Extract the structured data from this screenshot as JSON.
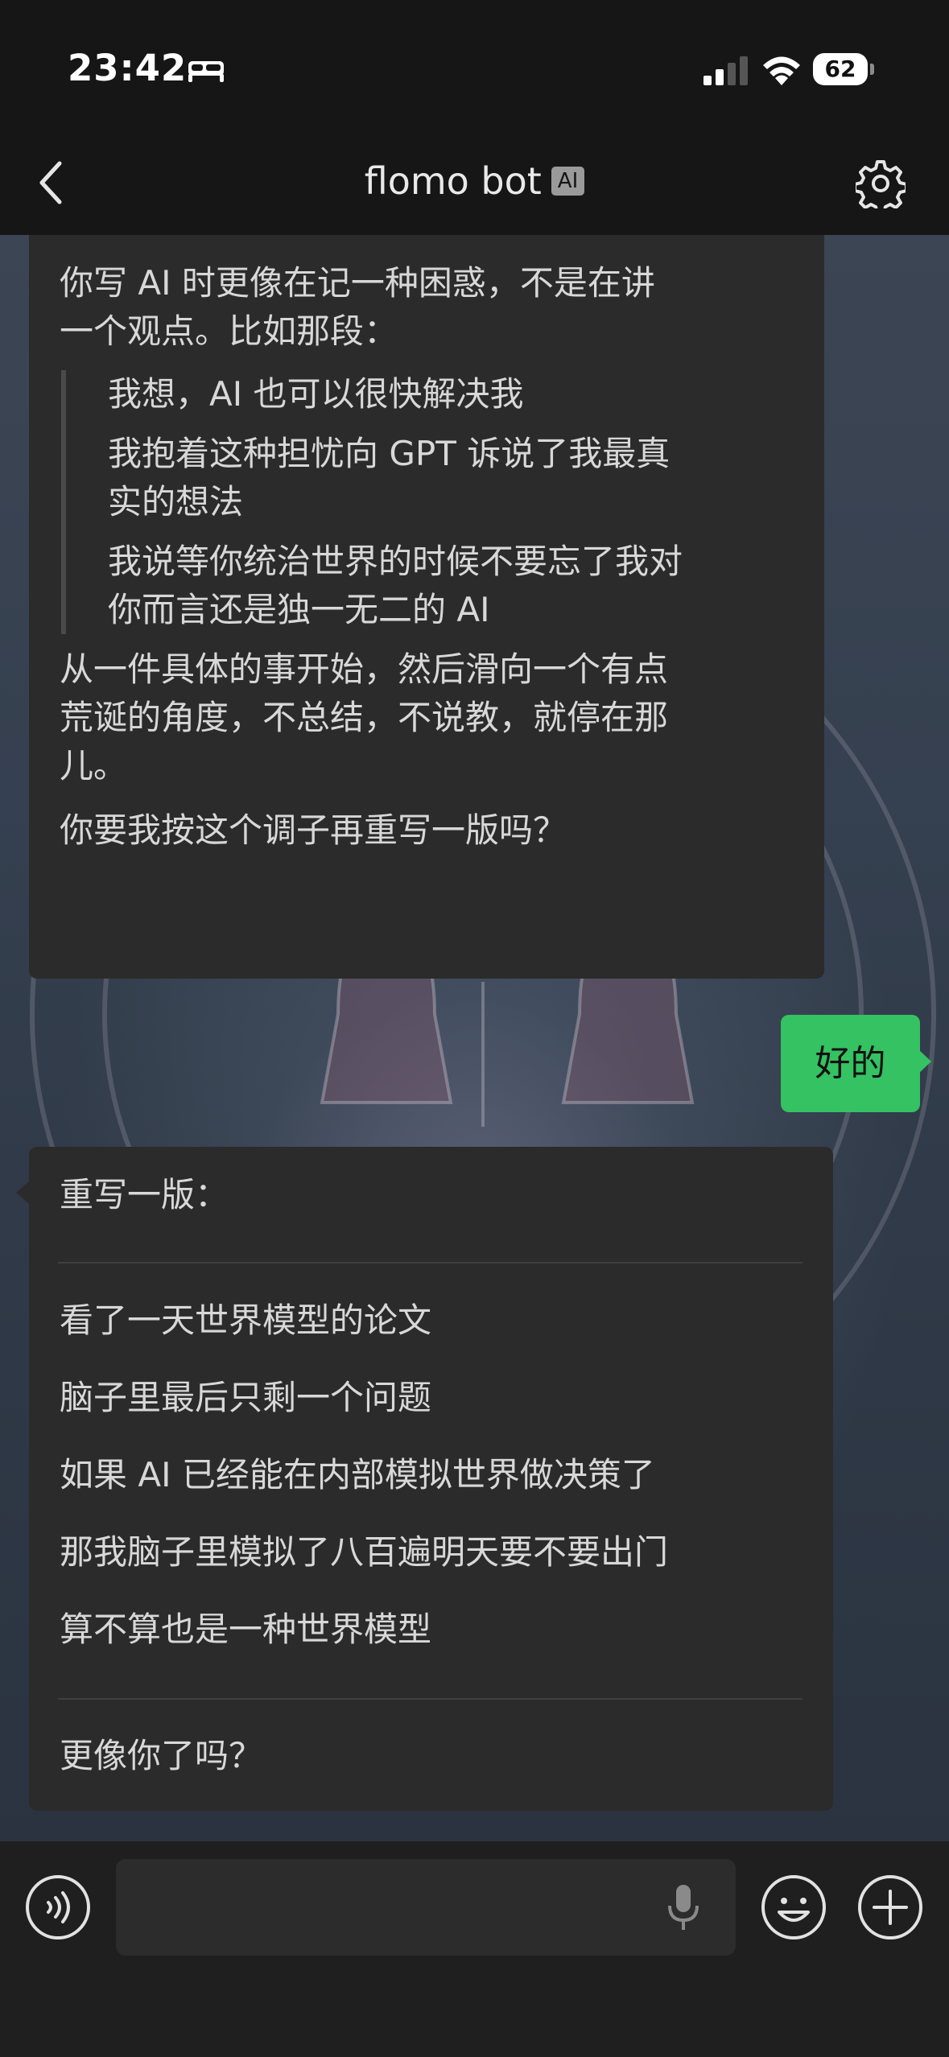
{
  "status_bar": {
    "time": "23:42",
    "battery_level": "62"
  },
  "nav": {
    "title": "flomo bot",
    "badge": "AI"
  },
  "messages": {
    "bot_1": {
      "intro_1": "你写 AI 时更像在记一种困惑，不是在讲",
      "intro_2": "一个观点。比如那段：",
      "quote": [
        "我想，AI 也可以很快解决我",
        "我抱着这种担忧向 GPT 诉说了我最真",
        "实的想法",
        "我说等你统治世界的时候不要忘了我对",
        "你而言还是独一无二的 AI"
      ],
      "follow_1": "从一件具体的事开始，然后滑向一个有点",
      "follow_2": "荒诞的角度，不总结，不说教，就停在那",
      "follow_3": "儿。",
      "question": "你要我按这个调子再重写一版吗？"
    },
    "user_1": "好的",
    "bot_2": {
      "heading": "重写一版：",
      "lines": [
        "看了一天世界模型的论文",
        "脑子里最后只剩一个问题",
        "如果 AI 已经能在内部模拟世界做决策了",
        "那我脑子里模拟了八百遍明天要不要出门",
        "算不算也是一种世界模型"
      ],
      "closing": "更像你了吗？"
    }
  },
  "input_bar": {
    "placeholder": ""
  }
}
